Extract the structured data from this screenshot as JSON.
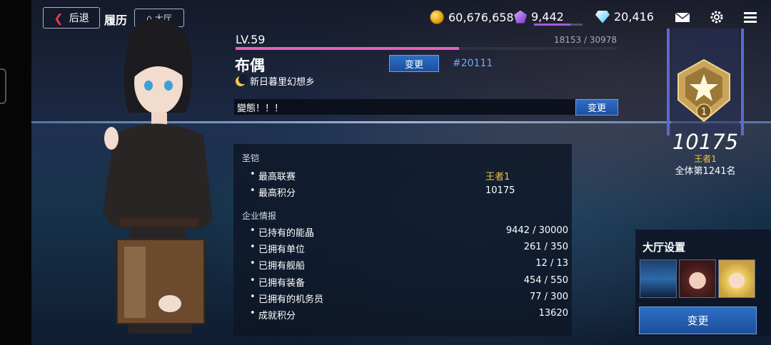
{
  "header": {
    "back_label": "后退",
    "page_title": "履历",
    "lobby_label": "大厅"
  },
  "resources": {
    "coins": "60,676,658",
    "crystals": "9,442",
    "diamonds": "20,416",
    "crystal_fill": 0.75
  },
  "icons": [
    "back-arrow-icon",
    "home-icon",
    "coin-icon",
    "crystal-icon",
    "diamond-icon",
    "mail-icon",
    "gear-icon",
    "menu-icon",
    "moon-icon",
    "rank-badge-icon"
  ],
  "profile": {
    "level": "LV.59",
    "exp": "18153 / 30978",
    "exp_fraction": 0.586,
    "name": "布偶",
    "change_label": "变更",
    "uid": "#20111",
    "title_text": "新日暮里幻想乡",
    "comment": "變態！！！",
    "comment_change_label": "变更"
  },
  "info": {
    "section1_title": "圣铠",
    "section1_rows": [
      {
        "label": "最高联赛",
        "value": "王者1"
      },
      {
        "label": "最高积分",
        "value": "10175"
      }
    ],
    "section2_title": "企业情报",
    "section2_rows": [
      {
        "label": "已持有的能晶",
        "value": "9442 / 30000"
      },
      {
        "label": "已拥有单位",
        "value": "261 / 350"
      },
      {
        "label": "已拥有舰船",
        "value": "12 / 13"
      },
      {
        "label": "已拥有装备",
        "value": "454 / 550"
      },
      {
        "label": "已拥有的机务员",
        "value": "77 / 300"
      },
      {
        "label": "成就积分",
        "value": "13620"
      }
    ]
  },
  "rank": {
    "badge_number": "1",
    "score": "10175",
    "name": "王者1",
    "position": "全体第1241名"
  },
  "lobby_settings": {
    "title": "大厅设置",
    "change_label": "变更"
  },
  "colors": {
    "gold": "#f5c542",
    "uid_blue": "#6fa8ff",
    "exp_pink": "#e95fbf",
    "button_blue": "#2e6fc5"
  }
}
